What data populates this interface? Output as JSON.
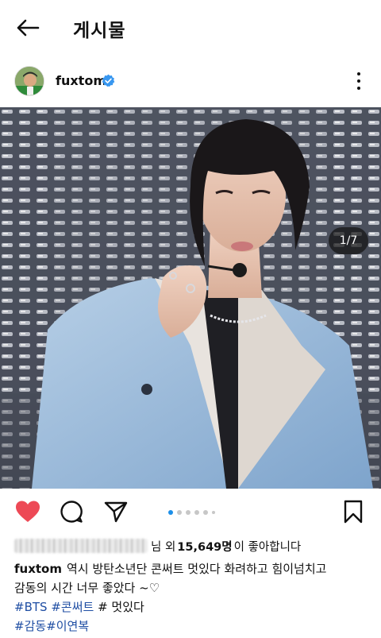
{
  "header": {
    "title": "게시물",
    "back_icon": "arrow-left-icon"
  },
  "post": {
    "author": "fuxtom",
    "verified": true,
    "slide_counter": "1/7",
    "slide_total": 7,
    "slide_current": 1,
    "likes_prefix": "님 외",
    "likes_count": "15,649명",
    "likes_suffix": "이 좋아합니다",
    "caption_user": "fuxtom",
    "caption_line1": "역시 방탄소년단 콘써트 멋있다  화려하고 힘이넘치고",
    "caption_line2": "감동의 시간  너무 좋았다 ~♡",
    "tags_line1": [
      {
        "text": "#BTS",
        "kind": "tag"
      },
      {
        "text": "#콘써트",
        "kind": "tag"
      },
      {
        "text": "# 멋있다",
        "kind": "plain"
      }
    ],
    "tags_line2": [
      {
        "text": "#감동",
        "kind": "tag"
      },
      {
        "text": "#이연복",
        "kind": "tag"
      }
    ]
  },
  "colors": {
    "like": "#ed4956",
    "link": "#1f4ea3",
    "verified": "#3897f0",
    "dot_active": "#1c8fe8"
  }
}
